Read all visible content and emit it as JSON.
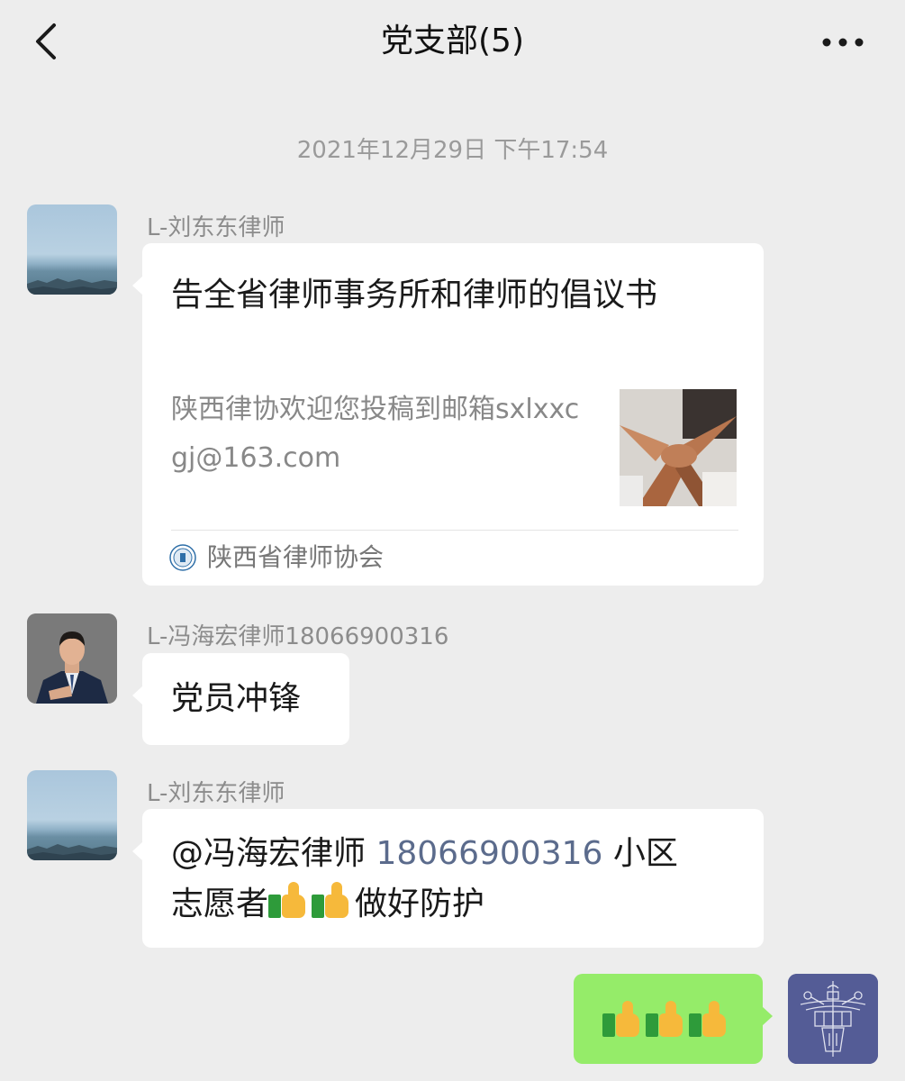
{
  "header": {
    "title": "党支部(5)",
    "back_icon": "chevron-left-icon",
    "more_icon": "ellipsis-icon"
  },
  "timestamp": "2021年12月29日 下午17:54",
  "messages": [
    {
      "sender": "L-刘东东律师",
      "type": "link-card",
      "card": {
        "title": "告全省律师事务所和律师的倡议书",
        "description": "陕西律协欢迎您投稿到邮箱sxlxxcgj@163.com",
        "source": "陕西省律师协会"
      }
    },
    {
      "sender": "L-冯海宏律师18066900316",
      "type": "text",
      "text": "党员冲锋"
    },
    {
      "sender": "L-刘东东律师",
      "type": "text",
      "mention": "@冯海宏律师",
      "mention_phone": "18066900316",
      "line1_rest": "小区",
      "line2_pre": "志愿者",
      "line2_post": "做好防护",
      "emoji": "thumbs-up",
      "emoji_count": 2
    },
    {
      "sender": "self",
      "type": "emoji",
      "emoji": "thumbs-up",
      "emoji_count": 3
    }
  ],
  "colors": {
    "background": "#ededed",
    "bubble_incoming": "#ffffff",
    "bubble_outgoing": "#95ec69",
    "mention_phone": "#5b6b8c",
    "meta_text": "#8c8c8c"
  }
}
